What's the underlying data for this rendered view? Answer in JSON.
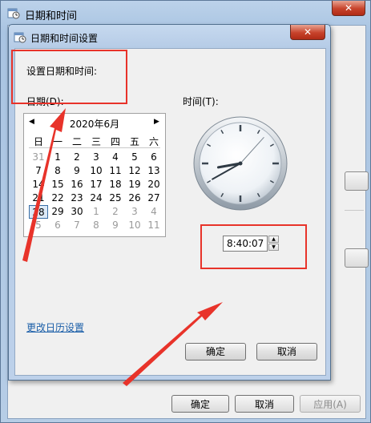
{
  "outer_window": {
    "title": "日期和时间",
    "close_symbol": "✕",
    "ok_label": "确定",
    "cancel_label": "取消",
    "apply_label": "应用(A)"
  },
  "dialog": {
    "title": "日期和时间设置",
    "close_symbol": "✕",
    "heading": "设置日期和时间:",
    "date_label": "日期(D):",
    "time_label": "时间(T):",
    "calendar": {
      "prev_symbol": "◀",
      "next_symbol": "▶",
      "month_title": "2020年6月",
      "weekdays": [
        "日",
        "一",
        "二",
        "三",
        "四",
        "五",
        "六"
      ],
      "weeks": [
        [
          "31",
          "1",
          "2",
          "3",
          "4",
          "5",
          "6"
        ],
        [
          "7",
          "8",
          "9",
          "10",
          "11",
          "12",
          "13"
        ],
        [
          "14",
          "15",
          "16",
          "17",
          "18",
          "19",
          "20"
        ],
        [
          "21",
          "22",
          "23",
          "24",
          "25",
          "26",
          "27"
        ],
        [
          "28",
          "29",
          "30",
          "1",
          "2",
          "3",
          "4"
        ],
        [
          "5",
          "6",
          "7",
          "8",
          "9",
          "10",
          "11"
        ]
      ],
      "selected_day": "28"
    },
    "clock": {
      "hour": 8,
      "minute": 40,
      "second": 7
    },
    "time_value": "8:40:07",
    "spin_up": "▲",
    "spin_down": "▼",
    "calendar_link": "更改日历设置",
    "ok_label": "确定",
    "cancel_label": "取消"
  },
  "colors": {
    "annotation_red": "#e8332a",
    "link_blue": "#1a5ea8"
  }
}
